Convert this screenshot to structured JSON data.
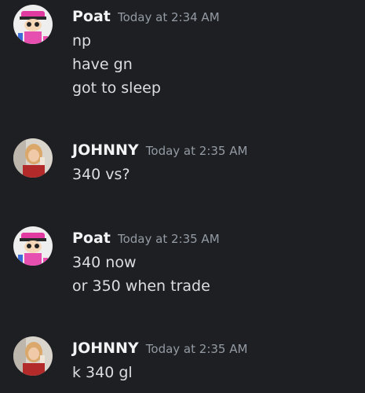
{
  "messages": [
    {
      "author": "Poat",
      "avatar": "cartoon-character-avatar",
      "timestamp": "Today at 2:34 AM",
      "lines": [
        "np",
        "have gn",
        "got to sleep"
      ]
    },
    {
      "author": "JOHNNY",
      "avatar": "photo-woman-avatar",
      "timestamp": "Today at 2:35 AM",
      "lines": [
        "340 vs?"
      ]
    },
    {
      "author": "Poat",
      "avatar": "cartoon-character-avatar",
      "timestamp": "Today at 2:35 AM",
      "lines": [
        "340 now",
        "or 350 when trade"
      ]
    },
    {
      "author": "JOHNNY",
      "avatar": "photo-woman-avatar",
      "timestamp": "Today at 2:35 AM",
      "lines": [
        "k 340 gl"
      ]
    }
  ],
  "colors": {
    "background": "#1e1f22",
    "username": "#f2f3f5",
    "timestamp": "#949ba4",
    "text": "#dbdee1"
  }
}
